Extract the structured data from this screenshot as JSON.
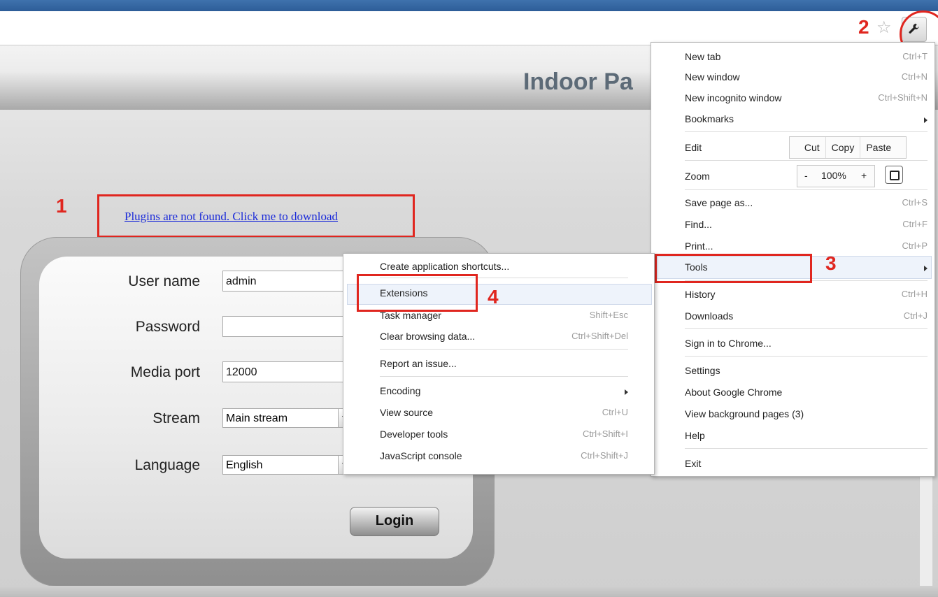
{
  "browser": {
    "star_icon": "star-outline-icon",
    "wrench_icon": "wrench-icon"
  },
  "annotations": {
    "step1": "1",
    "step2": "2",
    "step3": "3",
    "step4": "4"
  },
  "page": {
    "header_title": "Indoor Pa",
    "plugin_link": "Plugins are not found. Click me to download"
  },
  "login_form": {
    "username_label": "User name",
    "username_value": "admin",
    "password_label": "Password",
    "password_value": "",
    "media_port_label": "Media port",
    "media_port_value": "12000",
    "stream_label": "Stream",
    "stream_value": "Main stream",
    "language_label": "Language",
    "language_value": "English",
    "login_button": "Login"
  },
  "chrome_menu": {
    "new_tab": "New tab",
    "new_tab_shortcut": "Ctrl+T",
    "new_window": "New window",
    "new_window_shortcut": "Ctrl+N",
    "incognito": "New incognito window",
    "incognito_shortcut": "Ctrl+Shift+N",
    "bookmarks": "Bookmarks",
    "edit": "Edit",
    "cut": "Cut",
    "copy": "Copy",
    "paste": "Paste",
    "zoom": "Zoom",
    "zoom_minus": "-",
    "zoom_value": "100%",
    "zoom_plus": "+",
    "save_page": "Save page as...",
    "save_page_shortcut": "Ctrl+S",
    "find": "Find...",
    "find_shortcut": "Ctrl+F",
    "print": "Print...",
    "print_shortcut": "Ctrl+P",
    "tools": "Tools",
    "history": "History",
    "history_shortcut": "Ctrl+H",
    "downloads": "Downloads",
    "downloads_shortcut": "Ctrl+J",
    "sign_in": "Sign in to Chrome...",
    "settings": "Settings",
    "about": "About Google Chrome",
    "background_pages": "View background pages (3)",
    "help": "Help",
    "exit": "Exit"
  },
  "tools_menu": {
    "create_shortcuts": "Create application shortcuts...",
    "extensions": "Extensions",
    "task_manager": "Task manager",
    "task_manager_shortcut": "Shift+Esc",
    "clear_data": "Clear browsing data...",
    "clear_data_shortcut": "Ctrl+Shift+Del",
    "report_issue": "Report an issue...",
    "encoding": "Encoding",
    "view_source": "View source",
    "view_source_shortcut": "Ctrl+U",
    "developer_tools": "Developer tools",
    "developer_tools_shortcut": "Ctrl+Shift+I",
    "javascript_console": "JavaScript console",
    "javascript_console_shortcut": "Ctrl+Shift+J"
  }
}
